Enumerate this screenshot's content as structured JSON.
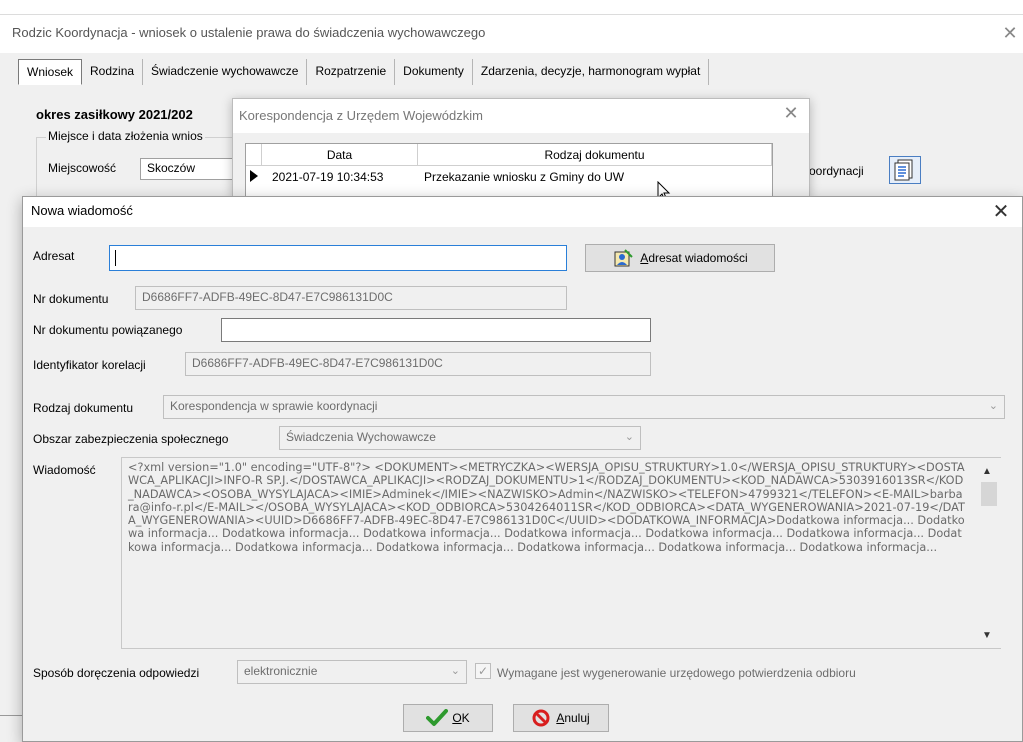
{
  "main_window": {
    "title": "Rodzic Koordynacja - wniosek o ustalenie prawa do świadczenia wychowawczego",
    "close_symbol": "✕",
    "tabs": [
      {
        "label": "Wniosek",
        "active": true
      },
      {
        "label": "Rodzina"
      },
      {
        "label": "Świadczenie wychowawcze"
      },
      {
        "label": "Rozpatrzenie"
      },
      {
        "label": "Dokumenty"
      },
      {
        "label": "Zdarzenia, decyzje, harmonogram wypłat"
      }
    ],
    "period_label": "okres zasiłkowy 2021/202",
    "place_group_label": "Miejsce i data złożenia wnios",
    "city_label": "Miejscowość",
    "city_value": "Skoczów",
    "coordination_label": "oordynacji"
  },
  "correspondence_dialog": {
    "title": "Korespondencja z Urzędem Wojewódzkim",
    "close_symbol": "✕",
    "columns": [
      "Data",
      "Rodzaj dokumentu"
    ],
    "rows": [
      {
        "date": "2021-07-19 10:34:53",
        "doc_type": "Przekazanie wniosku z Gminy do UW"
      }
    ]
  },
  "new_message_dialog": {
    "title": "Nowa wiadomość",
    "close_symbol": "✕",
    "recipient": {
      "label": "Adresat",
      "value": ""
    },
    "recipient_button": {
      "prefix": "",
      "underlined": "A",
      "rest": "dresat wiadomości"
    },
    "doc_number": {
      "label": "Nr dokumentu",
      "value": "D6686FF7-ADFB-49EC-8D47-E7C986131D0C"
    },
    "related_doc_number": {
      "label": "Nr dokumentu powiązanego",
      "value": ""
    },
    "correlation_id": {
      "label": "Identyfikator korelacji",
      "value": "D6686FF7-ADFB-49EC-8D47-E7C986131D0C"
    },
    "doc_type": {
      "label": "Rodzaj dokumentu",
      "value": "Korespondencja w sprawie koordynacji"
    },
    "security_area": {
      "label": "Obszar zabezpieczenia społecznego",
      "value": "Świadczenia Wychowawcze"
    },
    "message": {
      "label": "Wiadomość",
      "value": "<?xml version=\"1.0\" encoding=\"UTF-8\"?>\n<DOKUMENT><METRYCZKA><WERSJA_OPISU_STRUKTURY>1.0</WERSJA_OPISU_STRUKTURY><DOSTAWCA_APLIKACJI>INFO-R SP.J.</DOSTAWCA_APLIKACJI><RODZAJ_DOKUMENTU>1</RODZAJ_DOKUMENTU><KOD_NADAWCA>5303916013SR</KOD_NADAWCA><OSOBA_WYSYLAJACA><IMIE>Adminek</IMIE><NAZWISKO>Admin</NAZWISKO><TELEFON>4799321</TELEFON><E-MAIL>barbara@info-r.pl</E-MAIL></OSOBA_WYSYLAJACA><KOD_ODBIORCA>5304264011SR</KOD_ODBIORCA><DATA_WYGENEROWANIA>2021-07-19</DATA_WYGENEROWANIA><UUID>D6686FF7-ADFB-49EC-8D47-E7C986131D0C</UUID><DODATKOWA_INFORMACJA>Dodatkowa informacja... Dodatkowa informacja... Dodatkowa informacja... Dodatkowa informacja... Dodatkowa informacja... Dodatkowa informacja... Dodatkowa informacja... Dodatkowa informacja... Dodatkowa informacja... Dodatkowa informacja... Dodatkowa informacja... Dodatkowa informacja... Dodatkowa informacja..."
    },
    "delivery_method": {
      "label": "Sposób doręczenia odpowiedzi",
      "value": "elektronicznie"
    },
    "confirmation_checkbox": {
      "label": "Wymagane jest wygenerowanie urzędowego potwierdzenia odbioru",
      "checked": true
    },
    "ok_button": {
      "underlined": "O",
      "rest": "K"
    },
    "cancel_button": {
      "underlined": "A",
      "rest": "nuluj"
    }
  },
  "icons": {
    "coordination": "document-list-icon",
    "recipient": "address-book-icon",
    "ok": "green-check-icon",
    "cancel": "red-prohibition-icon",
    "row_marker": "row-pointer-icon",
    "cursor": "mouse-pointer-icon"
  },
  "colors": {
    "focus_border": "#2a7fd8",
    "ok_check": "#2e9a2e",
    "cancel_icon": "#d81e1e",
    "dialog_bg": "#f0f0f0"
  }
}
